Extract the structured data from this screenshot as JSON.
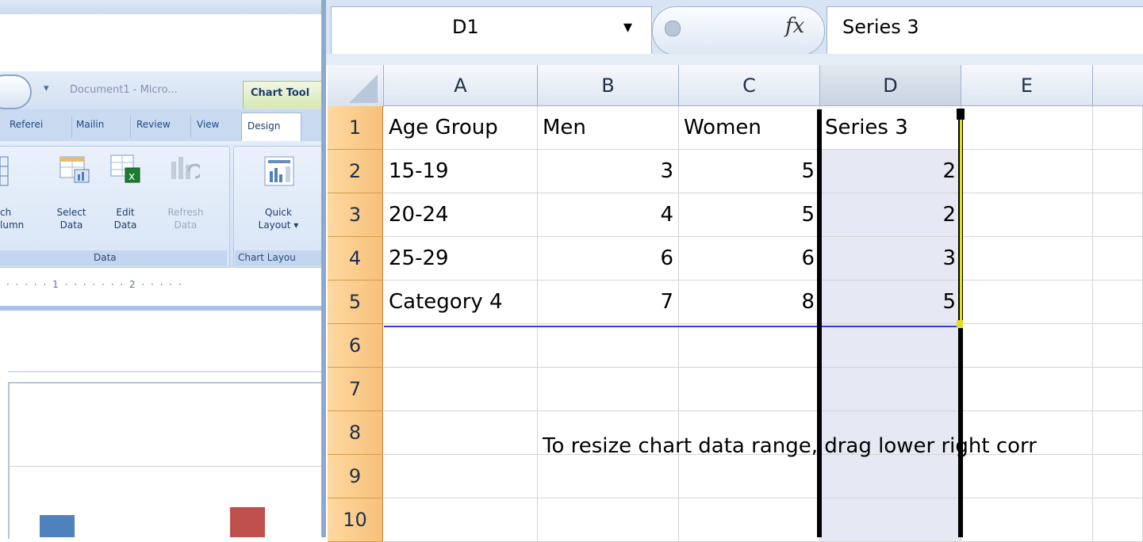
{
  "word": {
    "title_doc": "Document1 - Micro...",
    "chart_tools_label": "Chart Tool",
    "tabs": [
      "Referei",
      "Mailin",
      "Review",
      "View"
    ],
    "design_tab": "Design",
    "groups": {
      "data_caption": "Data",
      "chart_layout_caption": "Chart Layou"
    },
    "buttons": {
      "switch": [
        "ch",
        "lumn"
      ],
      "select_data": [
        "Select",
        "Data"
      ],
      "edit_data": [
        "Edit",
        "Data"
      ],
      "refresh_data": [
        "Refresh",
        "Data"
      ],
      "quick_layout": [
        "Quick",
        "Layout ▾"
      ]
    },
    "ruler": "· · · · · 1 · · · · · · · 2 · · · · ·",
    "bar_colors": [
      "#4f81bd",
      "#c0504d"
    ]
  },
  "excel": {
    "name_box": "D1",
    "fx_label": "fx",
    "formula_value": "Series 3",
    "columns": [
      "A",
      "B",
      "C",
      "D",
      "E"
    ],
    "rows": [
      {
        "num": "1",
        "a": "Age Group",
        "b": "Men",
        "c": "Women",
        "d": "Series 3"
      },
      {
        "num": "2",
        "a": "15-19",
        "b": "3",
        "c": "5",
        "d": "2"
      },
      {
        "num": "3",
        "a": "20-24",
        "b": "4",
        "c": "5",
        "d": "2"
      },
      {
        "num": "4",
        "a": "25-29",
        "b": "6",
        "c": "6",
        "d": "3"
      },
      {
        "num": "5",
        "a": "Category 4",
        "b": "7",
        "c": "8",
        "d": "5"
      },
      {
        "num": "6",
        "a": "",
        "b": "",
        "c": "",
        "d": ""
      },
      {
        "num": "7",
        "a": "",
        "b": "",
        "c": "",
        "d": ""
      },
      {
        "num": "8",
        "a": "",
        "b": "",
        "c": "",
        "d": ""
      },
      {
        "num": "9",
        "a": "",
        "b": "",
        "c": "",
        "d": ""
      },
      {
        "num": "10",
        "a": "",
        "b": "",
        "c": "",
        "d": ""
      }
    ],
    "note": "To resize chart data range, drag lower right corr"
  }
}
